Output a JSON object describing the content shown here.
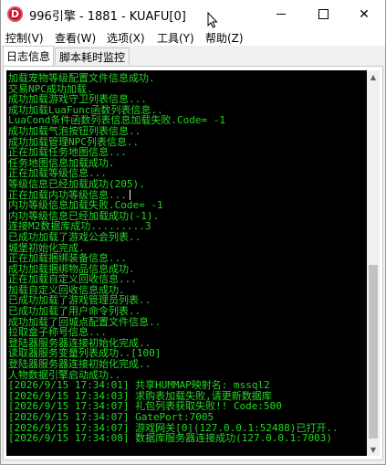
{
  "window": {
    "title": "996引擎 - 1881 - KUAFU[0]",
    "app_icon_letter": "D",
    "minimize_label": "—",
    "maximize_label": "",
    "close_label": "✕"
  },
  "menu": {
    "items": [
      {
        "label": "控制(V)"
      },
      {
        "label": "查看(W)"
      },
      {
        "label": "选项(X)"
      },
      {
        "label": "工具(Y)"
      },
      {
        "label": "帮助(Z)"
      }
    ]
  },
  "tabs": [
    {
      "label": "日志信息",
      "active": true
    },
    {
      "label": "脚本耗时监控",
      "active": false
    }
  ],
  "console": {
    "text_color": "#22d822",
    "background": "#000000",
    "lines": [
      "加载宠物等级配置文件信息成功.",
      "交易NPC成功加载.",
      "成功加载游戏守卫列表信息...",
      "成功加载LuaFunc函数列表信息..",
      "LuaCond条件函数列表信息加载失败.Code= -1",
      "成功加载气泡按钮列表信息..",
      "成功加载管理NPC列表信息..",
      "正在加载任务地图信息...",
      "任务地图信息加载成功.",
      "正在加载等级信息...",
      "等级信息已经加载成功(205).",
      "正在加载内功等级信息...",
      "内功等级信息加载失败.Code= -1",
      "内功等级信息已经加载成功(-1).",
      "连接M2数据库成功.........3",
      "已成功加载了游戏公会列表..",
      "城堡初始化完成.",
      "正在加载捆绑装备信息...",
      "成功加载捆绑物品信息成功.",
      "正在加载自定义回收信息...",
      "加载自定义回收信息成功.",
      "已成功加载了游戏管理员列表..",
      "已成功加载了用户命令列表..",
      "成功加载了回城点配置文件信息..",
      "拉取盒子称号信息...",
      "登陆器服务器连接初始化完成..",
      "读取器服务变量列表成功..[100]",
      "登陆器服务器连接初始化完成..",
      "人物数据引擎启动成功..",
      "[2026/9/15 17:34:01] 共享HUMMAP映射名: mssql2",
      "[2026/9/15 17:34:03] 求购表加载失败,请更新数据库",
      "[2026/9/15 17:34:07] 礼包列表获取失败!! Code:500",
      "[2026/9/15 17:34:07] GatePort:7005",
      "[2026/9/15 17:34:07] 游戏网关[0](127.0.0.1:52488)已打开..",
      "[2026/9/15 17:34:08] 数据库服务器连接成功(127.0.0.1:7003)"
    ]
  }
}
